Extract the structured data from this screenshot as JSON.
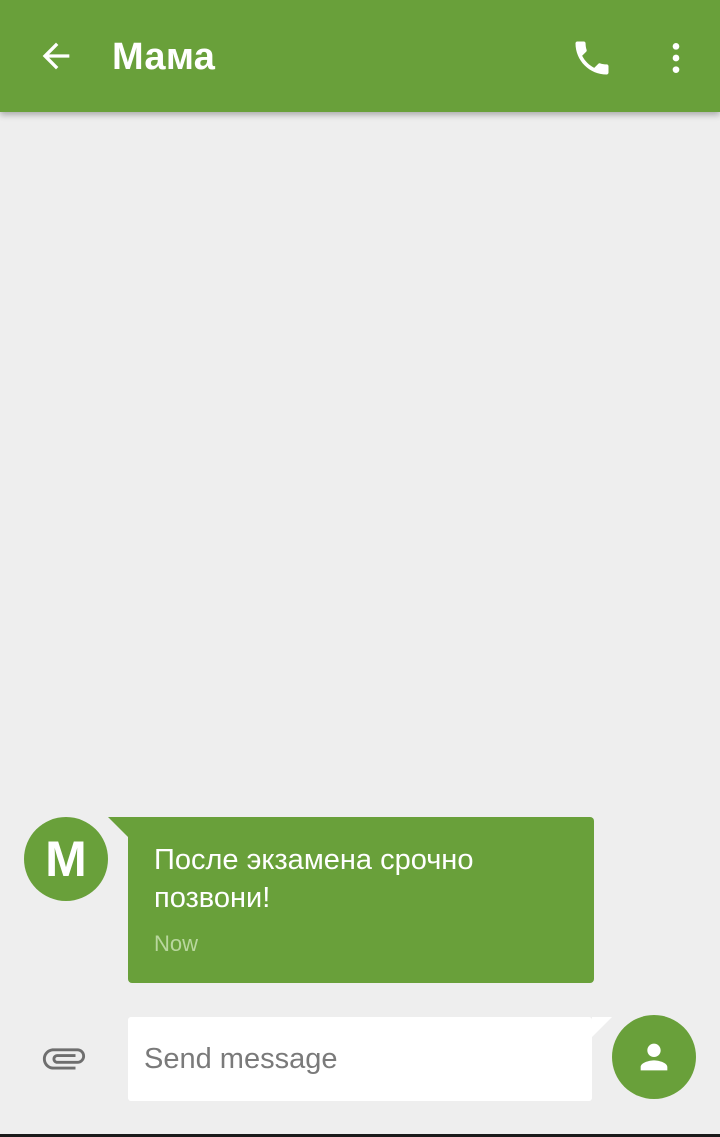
{
  "app_bar": {
    "title": "Мама",
    "back_icon": "arrow-back-icon",
    "call_icon": "phone-icon",
    "more_icon": "more-vert-icon",
    "color": "#69a03a"
  },
  "conversation": {
    "messages": [
      {
        "sender_initial": "M",
        "text": "После экзамена срочно позвони!",
        "time": "Now"
      }
    ]
  },
  "composer": {
    "placeholder": "Send message",
    "attach_icon": "paperclip-icon",
    "send_icon": "contact-person-icon"
  },
  "colors": {
    "accent": "#69a03a",
    "background": "#eeeeee",
    "time_text": "#b9d79e"
  }
}
